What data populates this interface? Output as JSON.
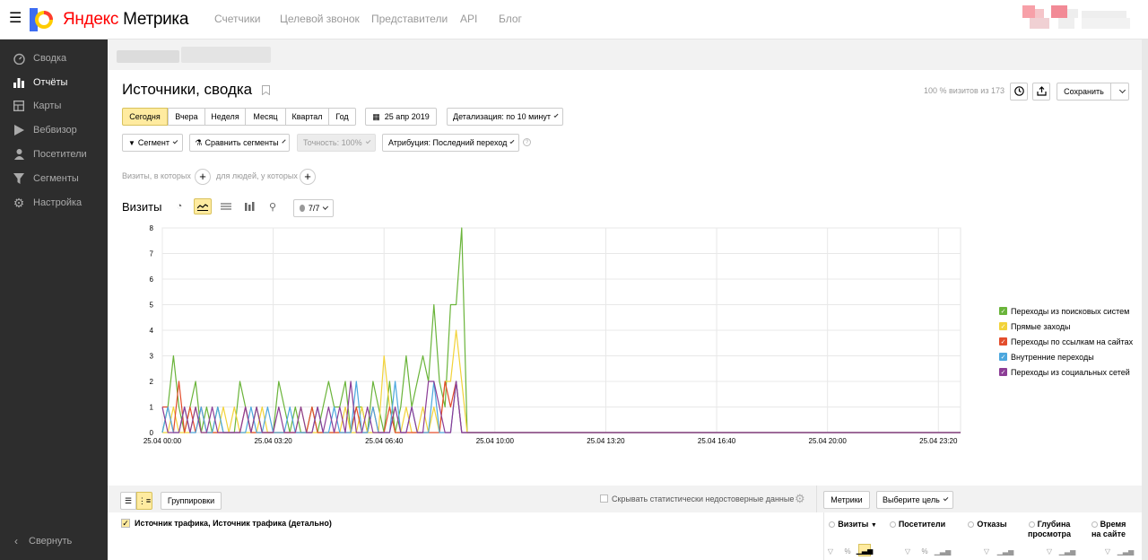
{
  "topbar": {
    "brand_prefix": "Яндекс",
    "brand_suffix": " Метрика",
    "nav": [
      "Счетчики",
      "Целевой звонок",
      "Представители",
      "API",
      "Блог"
    ]
  },
  "sidebar": {
    "items": [
      {
        "label": "Сводка",
        "icon": "gauge-icon"
      },
      {
        "label": "Отчёты",
        "icon": "bar-chart-icon",
        "active": true
      },
      {
        "label": "Карты",
        "icon": "map-icon"
      },
      {
        "label": "Вебвизор",
        "icon": "play-icon"
      },
      {
        "label": "Посетители",
        "icon": "user-icon"
      },
      {
        "label": "Сегменты",
        "icon": "filter-icon"
      },
      {
        "label": "Настройка",
        "icon": "gear-icon"
      }
    ],
    "collapse_label": "Свернуть"
  },
  "report": {
    "title": "Источники, сводка",
    "visits_share": "100 % визитов из 173",
    "save_label": "Сохранить",
    "periods": [
      "Сегодня",
      "Вчера",
      "Неделя",
      "Месяц",
      "Квартал",
      "Год"
    ],
    "active_period": "Сегодня",
    "date": "25 апр 2019",
    "detail": "Детализация: по 10 минут",
    "segment_label": "Сегмент",
    "compare_label": "Сравнить сегменты",
    "accuracy_label": "Точность: 100%",
    "attribution_label": "Атрибуция: Последний переход",
    "filter_visits": "Визиты, в которых",
    "filter_people": "для людей, у которых",
    "chart_title": "Визиты",
    "series_count": "7/7"
  },
  "table": {
    "groupings_label": "Группировки",
    "hide_unreliable": "Скрывать статистически недостоверные данные",
    "metrics_label": "Метрики",
    "goal_label": "Выберите цель",
    "dimension_header": "Источник трафика, Источник трафика (детально)",
    "columns": [
      "Визиты",
      "Посетители",
      "Отказы",
      "Глубина просмотра",
      "Время на сайте"
    ]
  },
  "chart_data": {
    "type": "line",
    "ylim": [
      0,
      8
    ],
    "yticks": [
      0,
      1,
      2,
      3,
      4,
      5,
      6,
      7,
      8
    ],
    "xticks": [
      "25.04 00:00",
      "25.04 03:20",
      "25.04 06:40",
      "25.04 10:00",
      "25.04 13:20",
      "25.04 16:40",
      "25.04 20:00",
      "25.04 23:20"
    ],
    "x_start": "25.04 00:00",
    "x_step_minutes": 10,
    "series": [
      {
        "name": "Переходы из поисковых систем",
        "color": "#6ab43a",
        "values": [
          0,
          1,
          3,
          1,
          0,
          1,
          2,
          0,
          1,
          0,
          1,
          0,
          0,
          0,
          2,
          1,
          0,
          1,
          0,
          0,
          0,
          2,
          1,
          0,
          1,
          0,
          0,
          1,
          0,
          1,
          2,
          1,
          1,
          2,
          0,
          1,
          1,
          0,
          2,
          1,
          0,
          2,
          0,
          1,
          3,
          1,
          2,
          3,
          2,
          5,
          2,
          1,
          5,
          5,
          8,
          0
        ]
      },
      {
        "name": "Прямые заходы",
        "color": "#f2d33a",
        "values": [
          0,
          0,
          1,
          0,
          0,
          0,
          1,
          0,
          0,
          0,
          0,
          1,
          0,
          1,
          0,
          0,
          0,
          0,
          1,
          0,
          0,
          0,
          0,
          0,
          0,
          1,
          0,
          0,
          0,
          0,
          0,
          0,
          0,
          1,
          0,
          0,
          1,
          0,
          0,
          0,
          3,
          1,
          0,
          0,
          1,
          0,
          0,
          1,
          0,
          1,
          0,
          2,
          2,
          4,
          2,
          0
        ]
      },
      {
        "name": "Переходы по ссылкам на сайтах",
        "color": "#e34d2c",
        "values": [
          1,
          1,
          0,
          2,
          0,
          1,
          0,
          1,
          0,
          0,
          0,
          0,
          0,
          0,
          0,
          1,
          0,
          0,
          0,
          0,
          0,
          0,
          0,
          0,
          0,
          0,
          0,
          1,
          0,
          0,
          0,
          0,
          0,
          0,
          0,
          1,
          0,
          0,
          1,
          0,
          0,
          1,
          0,
          0,
          0,
          0,
          0,
          0,
          0,
          0,
          0,
          2,
          1,
          2,
          0,
          0
        ]
      },
      {
        "name": "Внутренние переходы",
        "color": "#4ca7de",
        "values": [
          0,
          1,
          0,
          0,
          1,
          0,
          0,
          1,
          0,
          0,
          1,
          0,
          0,
          0,
          0,
          0,
          1,
          0,
          0,
          1,
          0,
          0,
          0,
          1,
          0,
          0,
          0,
          0,
          1,
          0,
          0,
          1,
          0,
          0,
          0,
          2,
          0,
          0,
          1,
          0,
          0,
          0,
          2,
          0,
          0,
          1,
          0,
          0,
          0,
          2,
          0,
          0,
          0,
          2,
          0,
          0
        ]
      },
      {
        "name": "Переходы из социальных сетей",
        "color": "#8c3d96",
        "values": [
          1,
          0,
          0,
          0,
          1,
          0,
          1,
          0,
          0,
          1,
          0,
          0,
          0,
          0,
          0,
          1,
          0,
          1,
          0,
          0,
          0,
          1,
          0,
          0,
          0,
          1,
          0,
          0,
          1,
          0,
          1,
          0,
          1,
          0,
          2,
          0,
          0,
          1,
          0,
          0,
          0,
          0,
          1,
          0,
          0,
          1,
          0,
          0,
          2,
          2,
          1,
          0,
          0,
          2,
          0,
          0
        ]
      }
    ]
  }
}
